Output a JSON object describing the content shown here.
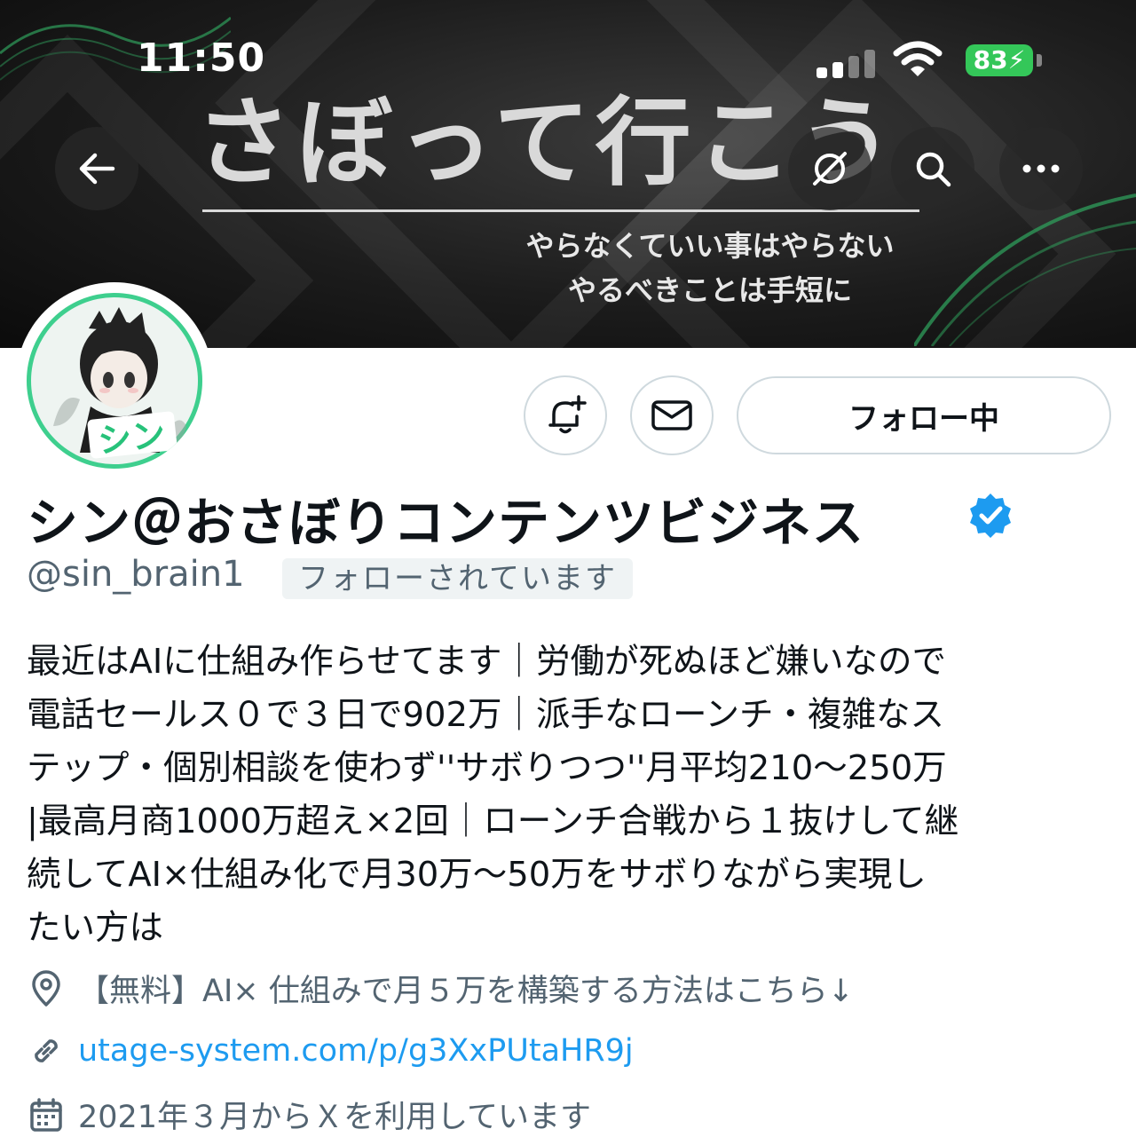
{
  "status_bar": {
    "time": "11:50",
    "battery": "83",
    "battery_color": "#34c759"
  },
  "banner": {
    "title": "さぼって行こう",
    "subtitle_line1": "やらなくていい事はやらない",
    "subtitle_line2": "やるべきことは手短に"
  },
  "nav": {
    "back_icon": "arrow-left-icon",
    "grok_icon": "grok-icon",
    "search_icon": "search-icon",
    "more_icon": "more-horizontal-icon"
  },
  "actions": {
    "notify_icon": "bell-plus-icon",
    "message_icon": "envelope-icon",
    "follow_label": "フォロー中"
  },
  "profile": {
    "display_name": "シン＠おさぼりコンテンツビジネス",
    "handle": "@sin_brain1",
    "follows_you": "フォローされています",
    "verified_color": "#1d9bf0",
    "bio_lines": [
      "最近はAIに仕組み作らせてます｜労働が死ぬほど嫌いなので",
      "電話セールス０で３日で902万｜派手なローンチ・複雑なス",
      "テップ・個別相談を使わず''サボりつつ''月平均210〜250万",
      "|最高月商1000万超え×2回｜ローンチ合戦から１抜けして継",
      "続してAI×仕組み化で月30万〜50万をサボりながら実現し",
      "たい方は"
    ],
    "location": "【無料】AI× 仕組みで月５万を構築する方法はこちら↓",
    "url": "utage-system.com/p/g3XxPUtaHR9j",
    "joined": "2021年３月からＸを利用しています",
    "link_color": "#1d9bf0"
  }
}
